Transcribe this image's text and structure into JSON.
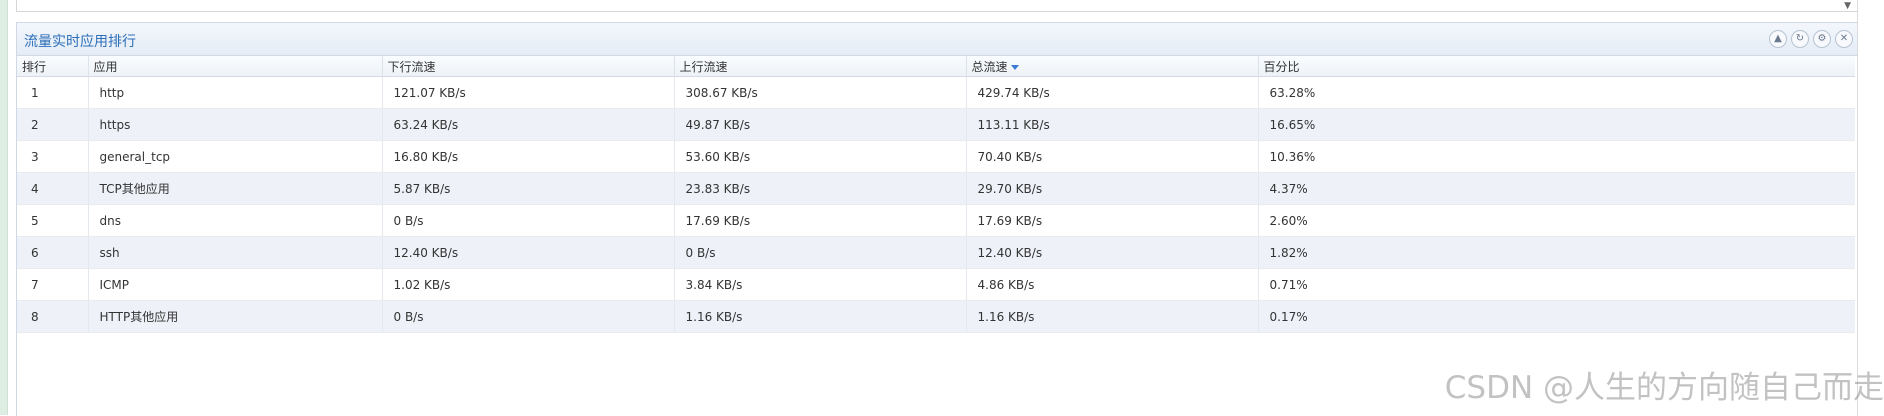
{
  "panel": {
    "title": "流量实时应用排行"
  },
  "table": {
    "columns": [
      "排行",
      "应用",
      "下行流速",
      "上行流速",
      "总流速",
      "百分比"
    ],
    "sorted_column": "总流速",
    "rows": [
      {
        "rank": "1",
        "app": "http",
        "down": "121.07 KB/s",
        "up": "308.67 KB/s",
        "total": "429.74 KB/s",
        "pct": "63.28%"
      },
      {
        "rank": "2",
        "app": "https",
        "down": "63.24 KB/s",
        "up": "49.87 KB/s",
        "total": "113.11 KB/s",
        "pct": "16.65%"
      },
      {
        "rank": "3",
        "app": "general_tcp",
        "down": "16.80 KB/s",
        "up": "53.60 KB/s",
        "total": "70.40 KB/s",
        "pct": "10.36%"
      },
      {
        "rank": "4",
        "app": "TCP其他应用",
        "down": "5.87 KB/s",
        "up": "23.83 KB/s",
        "total": "29.70 KB/s",
        "pct": "4.37%"
      },
      {
        "rank": "5",
        "app": "dns",
        "down": "0 B/s",
        "up": "17.69 KB/s",
        "total": "17.69 KB/s",
        "pct": "2.60%"
      },
      {
        "rank": "6",
        "app": "ssh",
        "down": "12.40 KB/s",
        "up": "0 B/s",
        "total": "12.40 KB/s",
        "pct": "1.82%"
      },
      {
        "rank": "7",
        "app": "ICMP",
        "down": "1.02 KB/s",
        "up": "3.84 KB/s",
        "total": "4.86 KB/s",
        "pct": "0.71%"
      },
      {
        "rank": "8",
        "app": "HTTP其他应用",
        "down": "0 B/s",
        "up": "1.16 KB/s",
        "total": "1.16 KB/s",
        "pct": "0.17%"
      }
    ]
  },
  "watermark": "CSDN @人生的方向随自己而走",
  "icons": {
    "collapse": "chevron-up-icon",
    "refresh": "refresh-icon",
    "settings": "gear-icon",
    "close": "close-icon"
  }
}
